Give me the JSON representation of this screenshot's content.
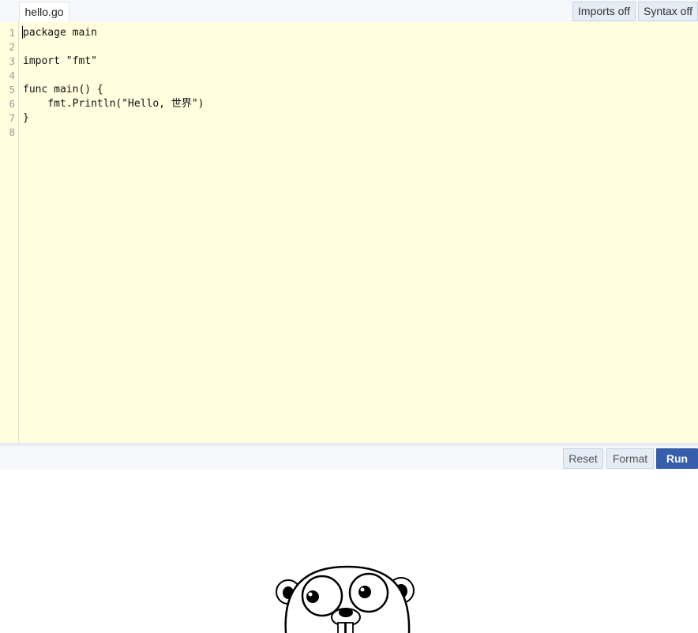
{
  "header": {
    "file_tab": "hello.go",
    "imports_button": "Imports off",
    "syntax_button": "Syntax off"
  },
  "editor": {
    "line_numbers": [
      "1",
      "2",
      "3",
      "4",
      "5",
      "6",
      "7",
      "8"
    ],
    "lines": [
      "package main",
      "",
      "import \"fmt\"",
      "",
      "func main() {",
      "    fmt.Println(\"Hello, 世界\")",
      "}",
      ""
    ]
  },
  "footer": {
    "reset_button": "Reset",
    "format_button": "Format",
    "run_button": "Run"
  },
  "colors": {
    "editor_bg": "#fffedf",
    "run_button_bg": "#375eab",
    "button_bg": "#e4ecf5"
  },
  "icons": {
    "mascot": "gopher-mascot-icon"
  }
}
